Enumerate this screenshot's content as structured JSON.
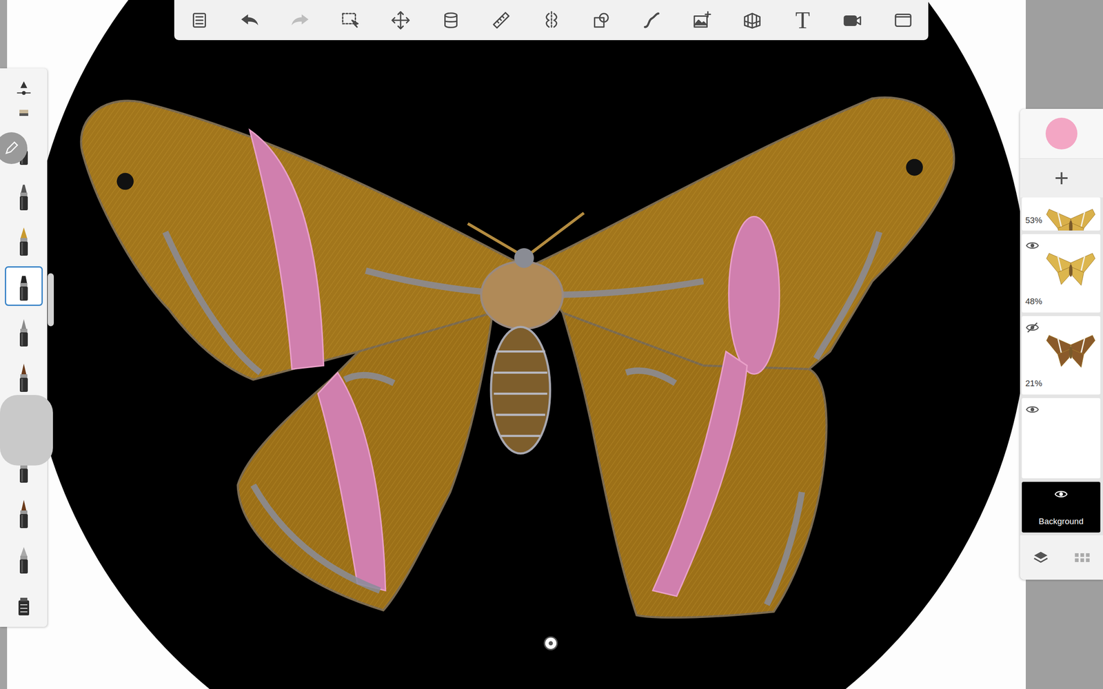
{
  "toolbar": {
    "undo": {
      "disabled": false
    },
    "redo": {
      "disabled": true
    },
    "text_tool": "T"
  },
  "brush_palette": {
    "items": [
      {
        "kind": "slider",
        "selected": false
      },
      {
        "kind": "cut",
        "selected": false
      },
      {
        "kind": "pencil",
        "selected": false
      },
      {
        "kind": "pen",
        "selected": false
      },
      {
        "kind": "nib",
        "selected": false
      },
      {
        "kind": "marker",
        "selected": true
      },
      {
        "kind": "brush",
        "selected": false
      },
      {
        "kind": "ink",
        "selected": false
      },
      {
        "kind": "brush",
        "selected": false
      },
      {
        "kind": "pen",
        "selected": false
      },
      {
        "kind": "ink",
        "selected": false
      },
      {
        "kind": "airbrush",
        "selected": false
      },
      {
        "kind": "library",
        "selected": false
      }
    ]
  },
  "color": {
    "current": "#f3a6c4"
  },
  "add_layer": "+",
  "layers": [
    {
      "label": "53%",
      "kind": "partial",
      "thumb": "#d9b04a",
      "selected": false
    },
    {
      "label": "48%",
      "kind": "full",
      "visible": true,
      "thumb": "#dcb64e",
      "selected": false
    },
    {
      "label": "21%",
      "kind": "full",
      "visible": false,
      "thumb": "#8a5a2a",
      "selected": false
    },
    {
      "kind": "empty",
      "visible": true,
      "selected": false
    },
    {
      "label": "Background",
      "kind": "background",
      "visible": true,
      "selected": false
    }
  ]
}
